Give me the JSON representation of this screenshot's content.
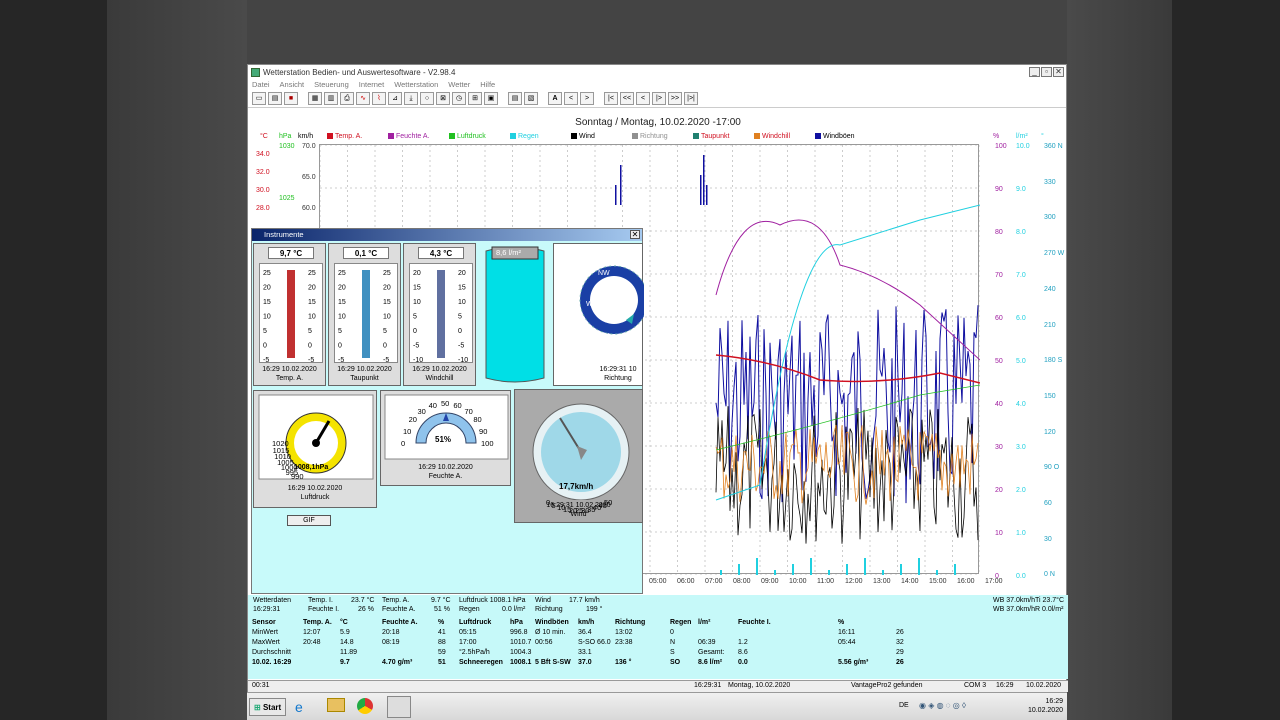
{
  "window": {
    "title": "Wetterstation Bedien- und Auswertesoftware - V2.98.4",
    "menu": [
      "Datei",
      "Ansicht",
      "Steuerung",
      "Internet",
      "Wetterstation",
      "Wetter",
      "Hilfe"
    ],
    "toolbar_text_buttons": [
      "A",
      "<",
      ">",
      "|<",
      "<<",
      "<",
      "|>",
      ">>",
      "|>|"
    ]
  },
  "chart": {
    "title": "Sonntag / Montag, 10.02.2020  -17:00",
    "unit_headers": {
      "left1": "°C",
      "left2": "hPa",
      "left3": "km/h",
      "right1": "%",
      "right2": "l/m²",
      "right3": "°"
    },
    "legend": [
      {
        "label": "Temp. A.",
        "color": "#d01020"
      },
      {
        "label": "Feuchte A.",
        "color": "#a020a0"
      },
      {
        "label": "Luftdruck",
        "color": "#20c020"
      },
      {
        "label": "Regen",
        "color": "#20d0e0"
      },
      {
        "label": "Wind",
        "color": "#000000"
      },
      {
        "label": "Richtung",
        "color": "#909090"
      },
      {
        "label": "Taupunkt",
        "color": "#208070"
      },
      {
        "label": "Windchill",
        "color": "#e08020"
      },
      {
        "label": "Windböen",
        "color": "#1010a0"
      }
    ],
    "left_temp_ticks": [
      "34.0",
      "32.0",
      "30.0",
      "28.0"
    ],
    "left_hpa_ticks": [
      "1030",
      "1025"
    ],
    "left_kmh_ticks": [
      "70.0",
      "65.0",
      "60.0"
    ],
    "right_pct_ticks": [
      "100",
      "90",
      "80",
      "70",
      "60",
      "50",
      "40",
      "30",
      "20",
      "10",
      "0"
    ],
    "right_rain_ticks": [
      "10.0",
      "9.0",
      "8.0",
      "7.0",
      "6.0",
      "5.0",
      "4.0",
      "3.0",
      "2.0",
      "1.0",
      "0.0"
    ],
    "right_dir_ticks": [
      "360 N",
      "330",
      "300",
      "270 W",
      "240",
      "210",
      "180 S",
      "150",
      "120",
      "90 O",
      "60",
      "30",
      "0 N"
    ],
    "x_ticks": [
      "05:00",
      "06:00",
      "07:00",
      "08:00",
      "09:00",
      "10:00",
      "11:00",
      "12:00",
      "13:00",
      "14:00",
      "15:00",
      "16:00",
      "17:00"
    ]
  },
  "instruments": {
    "title": "Instrumente",
    "temp_a": {
      "value": "9,7",
      "unit": "°C",
      "time": "16:29  10.02.2020",
      "label": "Temp. A.",
      "scale": [
        "25",
        "20",
        "15",
        "10",
        "5",
        "0",
        "-5"
      ]
    },
    "taupunkt": {
      "value": "0,1",
      "unit": "°C",
      "time": "16:29  10.02.2020",
      "label": "Taupunkt",
      "scale": [
        "25",
        "20",
        "15",
        "10",
        "5",
        "0",
        "-5"
      ]
    },
    "windchill": {
      "value": "4,3",
      "unit": "°C",
      "time": "16:29  10.02.2020",
      "label": "Windchill",
      "scale": [
        "20",
        "15",
        "10",
        "5",
        "0",
        "-5",
        "-10"
      ]
    },
    "rain": {
      "value": "8,6",
      "unit": "l/m²"
    },
    "compass": {
      "time": "16:29:31  10",
      "label": "Richtung",
      "n": "NW",
      "w": "W",
      "sw": "SW"
    },
    "luftdruck": {
      "ticks": [
        "990",
        "995",
        "1000",
        "1005",
        "1010",
        "1015",
        "1020"
      ],
      "value": "1008,1hPa",
      "time": "16:29  10.02.2020",
      "label": "Luftdruck"
    },
    "feuchte": {
      "ticks": [
        "0",
        "10",
        "20",
        "30",
        "40",
        "50",
        "60",
        "70",
        "80",
        "90",
        "100"
      ],
      "value": "51%",
      "time": "16:29  10.02.2020",
      "label": "Feuchte A."
    },
    "wind": {
      "ticks": [
        "0",
        "5",
        "10",
        "15",
        "20",
        "25",
        "30",
        "35",
        "40",
        "45",
        "50"
      ],
      "value": "17,7km/h",
      "time": "16:29:31    10.02.2020",
      "label": "Wind"
    },
    "gif_button": "GIF"
  },
  "status": {
    "row1": {
      "a": "Wetterdaten",
      "b": "Temp. I.",
      "c": "23.7 °C",
      "d": "Temp. A.",
      "e": "9.7 °C",
      "f": "Luftdruck 1008.1 hPa",
      "g": "Wind",
      "h": "17.7 km/h",
      "i": "WB 37.0km/hTi 23.7°C"
    },
    "row2": {
      "a": "16:29:31",
      "b": "Feuchte I.",
      "c": "26 %",
      "d": "Feuchte A.",
      "e": "51 %",
      "f": "Regen",
      "g": "0.0 l/m²",
      "h": "Richtung",
      "j": "199 °",
      "i": "WB 37.0km/hR 0.0l/m²"
    },
    "header": [
      "Sensor",
      "Temp. A.",
      "°C",
      "Feuchte A.",
      "%",
      "Luftdruck",
      "hPa",
      "Windböen",
      "km/h",
      "Richtung",
      "Regen",
      "l/m²",
      "Feuchte I.",
      "%"
    ],
    "minwert": [
      "MinWert",
      "12:07",
      "5.9",
      "20:18",
      "41",
      "05:15",
      "996.8",
      "Ø 10 min.",
      "36.4",
      "13:02",
      "0",
      "",
      "",
      "16:11",
      "26"
    ],
    "maxwert": [
      "MaxWert",
      "20:48",
      "14.8",
      "08:19",
      "88",
      "17:00",
      "1010.7",
      "00:56",
      "S-SO 66.0",
      "23:38",
      "N",
      "06:39",
      "1.2",
      "05:44",
      "32"
    ],
    "durchschnitt": [
      "Durchschnitt",
      "",
      "11.89",
      "",
      "59",
      "°2.5hPa/h",
      "1004.3",
      "",
      "33.1",
      "",
      "S",
      "Gesamt:",
      "8.6",
      "",
      "29"
    ],
    "current": [
      "10.02. 16:29",
      "",
      "9.7",
      "4.70 g/m³",
      "51",
      "Schneeregen",
      "1008.1",
      "5 Bft S-SW",
      "37.0",
      "136 °",
      "SO",
      "8.6 l/m²",
      "0.0",
      "5.56 g/m³",
      "26"
    ]
  },
  "statusbar": {
    "left": "00:31",
    "time": "16:29:31",
    "date": "Montag, 10.02.2020",
    "device": "VantagePro2 gefunden",
    "port": "COM 3",
    "clock": "16:29",
    "date2": "10.02.2020"
  },
  "taskbar": {
    "start": "Start",
    "lang": "DE",
    "time": "16:29",
    "date": "10.02.2020"
  }
}
